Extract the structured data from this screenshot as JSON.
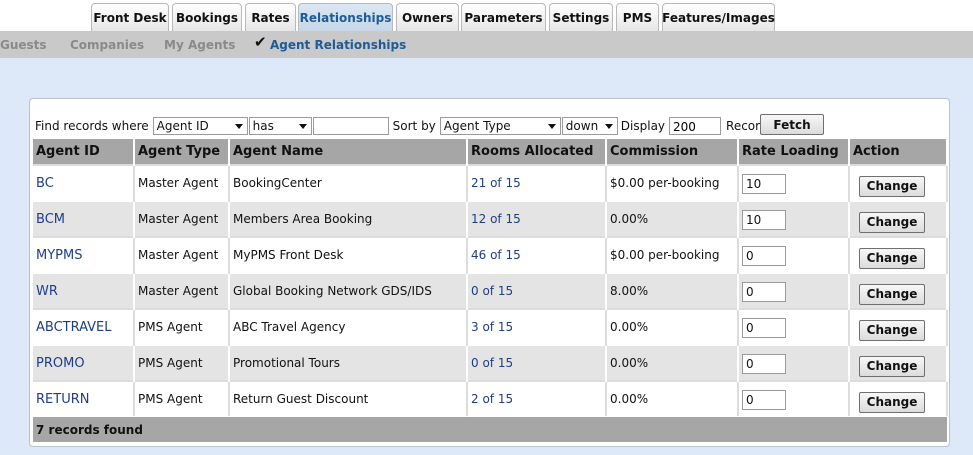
{
  "top_tabs": [
    "Front Desk",
    "Bookings",
    "Rates",
    "Relationships",
    "Owners",
    "Parameters",
    "Settings",
    "PMS",
    "Features/Images"
  ],
  "active_top_tab": "Relationships",
  "sub_tabs": [
    "Guests",
    "Companies",
    "My Agents",
    "Agent Relationships"
  ],
  "active_sub_tab": "Agent Relationships",
  "filter": {
    "find_label": "Find records where",
    "field_value": "Agent ID",
    "operator_value": "has",
    "search_value": "",
    "sort_label": "Sort by",
    "sort_value": "Agent Type",
    "direction_value": "down",
    "display_label": "Display",
    "display_value": "200",
    "records_label": "Records",
    "fetch_label": "Fetch"
  },
  "table": {
    "headers": [
      "Agent ID",
      "Agent Type",
      "Agent Name",
      "Rooms Allocated",
      "Commission",
      "Rate Loading",
      "Action"
    ],
    "rows": [
      {
        "agent_id": "BC",
        "agent_type": "Master Agent",
        "agent_name": "BookingCenter",
        "rooms": "21 of 15",
        "commission": "$0.00 per-booking",
        "rate_loading": "10",
        "action": "Change"
      },
      {
        "agent_id": "BCM",
        "agent_type": "Master Agent",
        "agent_name": "Members Area Booking",
        "rooms": "12 of 15",
        "commission": "0.00%",
        "rate_loading": "10",
        "action": "Change"
      },
      {
        "agent_id": "MYPMS",
        "agent_type": "Master Agent",
        "agent_name": "MyPMS Front Desk",
        "rooms": "46 of 15",
        "commission": "$0.00 per-booking",
        "rate_loading": "0",
        "action": "Change"
      },
      {
        "agent_id": "WR",
        "agent_type": "Master Agent",
        "agent_name": "Global Booking Network GDS/IDS",
        "rooms": "0 of 15",
        "commission": "8.00%",
        "rate_loading": "0",
        "action": "Change"
      },
      {
        "agent_id": "ABCTRAVEL",
        "agent_type": "PMS Agent",
        "agent_name": "ABC Travel Agency",
        "rooms": "3 of 15",
        "commission": "0.00%",
        "rate_loading": "0",
        "action": "Change"
      },
      {
        "agent_id": "PROMO",
        "agent_type": "PMS Agent",
        "agent_name": "Promotional Tours",
        "rooms": "0 of 15",
        "commission": "0.00%",
        "rate_loading": "0",
        "action": "Change"
      },
      {
        "agent_id": "RETURN",
        "agent_type": "PMS Agent",
        "agent_name": "Return Guest Discount",
        "rooms": "2 of 15",
        "commission": "0.00%",
        "rate_loading": "0",
        "action": "Change"
      }
    ],
    "footer": "7 records found"
  }
}
